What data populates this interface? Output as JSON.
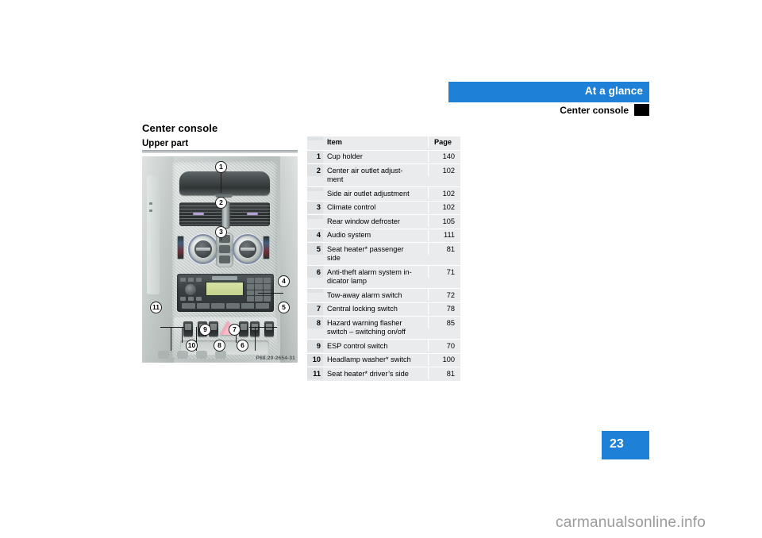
{
  "running_head": {
    "chapter": "At a glance",
    "section": "Center console"
  },
  "page": {
    "title": "Center console",
    "subtitle": "Upper part",
    "number": "23",
    "watermark": "carmanualsonline.info"
  },
  "figure": {
    "name": "center-console-upper-part-photo",
    "caption": "P68.20-2654-31",
    "callouts": [
      "1",
      "2",
      "3",
      "4",
      "5",
      "6",
      "7",
      "8",
      "9",
      "10",
      "11"
    ]
  },
  "table": {
    "headers": {
      "num": "",
      "item": "Item",
      "page": "Page"
    },
    "rows": [
      {
        "num": "1",
        "item": "Cup holder",
        "page": "140"
      },
      {
        "num": "2",
        "item": "Center air outlet adjust-\nment",
        "page": "102"
      },
      {
        "num": "",
        "item": "Side air outlet adjustment",
        "page": "102"
      },
      {
        "num": "3",
        "item": "Climate control",
        "page": "102"
      },
      {
        "num": "",
        "item": "Rear window defroster",
        "page": "105"
      },
      {
        "num": "4",
        "item": "Audio system",
        "page": "111"
      },
      {
        "num": "5",
        "item": "Seat heater* passenger\nside",
        "page": "81"
      },
      {
        "num": "6",
        "item": "Anti-theft alarm system in-\ndicator lamp",
        "page": "71"
      },
      {
        "num": "",
        "item": "Tow-away alarm switch",
        "page": "72"
      },
      {
        "num": "7",
        "item": "Central locking switch",
        "page": "78"
      },
      {
        "num": "8",
        "item": "Hazard warning flasher\nswitch – switching on/off",
        "page": "85"
      },
      {
        "num": "9",
        "item": "ESP control switch",
        "page": "70"
      },
      {
        "num": "10",
        "item": "Headlamp washer* switch",
        "page": "100"
      },
      {
        "num": "11",
        "item": "Seat heater* driver’s side",
        "page": "81"
      }
    ]
  },
  "colors": {
    "brand_blue": "#1f80d8",
    "table_bg": "#e9ebec",
    "table_num_bg": "#dfe2e4",
    "marker_black": "#000000",
    "watermark_gray": "#9b9b9b"
  }
}
